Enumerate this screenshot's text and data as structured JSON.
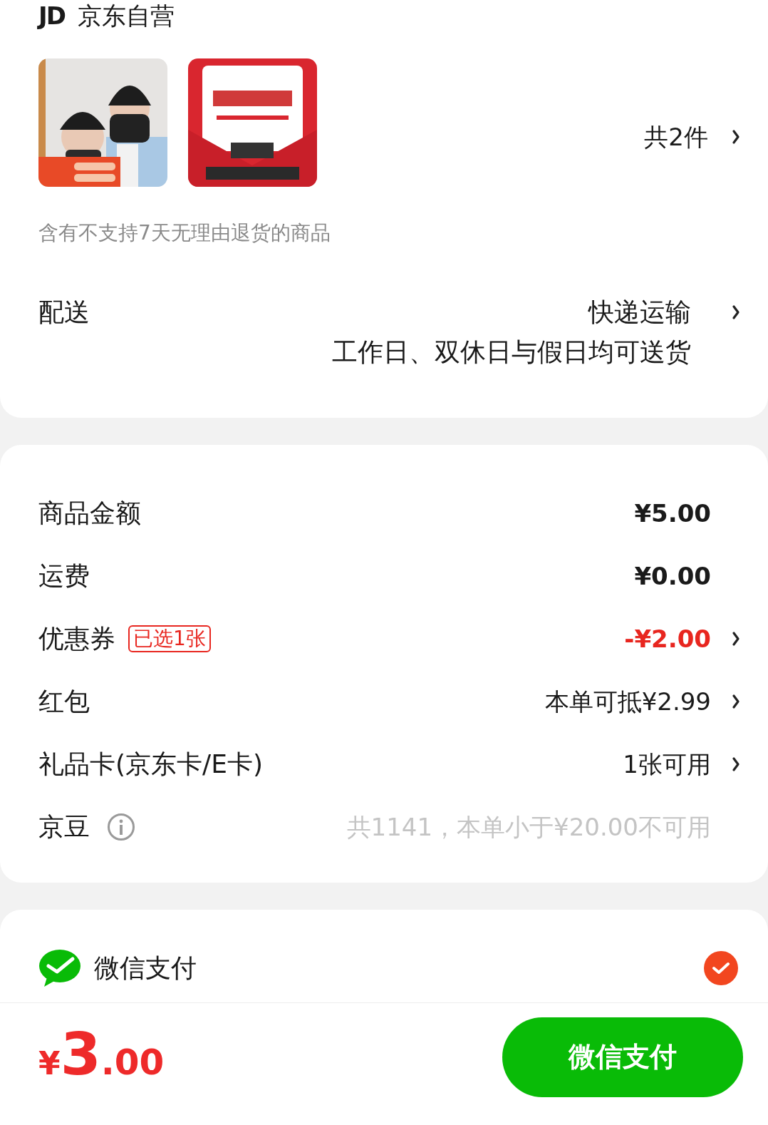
{
  "shop": {
    "logo": "JD",
    "name": "京东自营"
  },
  "products": {
    "count": "共2件"
  },
  "notice": "含有不支持7天无理由退货的商品",
  "delivery": {
    "label": "配送",
    "method": "快递运输",
    "schedule": "工作日、双休日与假日均可送货"
  },
  "summary": [
    {
      "label": "商品金额",
      "value": "¥5.00",
      "kind": "strong",
      "arrow": false,
      "info": false
    },
    {
      "label": "运费",
      "value": "¥0.00",
      "kind": "strong",
      "arrow": false,
      "info": false
    },
    {
      "label": "优惠券",
      "badge": "已选1张",
      "value": "-¥2.00",
      "kind": "discount",
      "arrow": true,
      "info": false
    },
    {
      "label": "红包",
      "value": "本单可抵¥2.99",
      "kind": "normal",
      "arrow": true,
      "info": false
    },
    {
      "label": "礼品卡(京东卡/E卡)",
      "value": "1张可用",
      "kind": "normal",
      "arrow": true,
      "info": false
    },
    {
      "label": "京豆",
      "value": "共1141，本单小于¥20.00不可用",
      "kind": "muted",
      "arrow": false,
      "info": true
    }
  ],
  "payment": [
    {
      "name": "微信支付",
      "selected": true
    }
  ],
  "footer": {
    "currency": "¥",
    "integer": "3",
    "decimals": ".00",
    "pay_button": "微信支付"
  }
}
